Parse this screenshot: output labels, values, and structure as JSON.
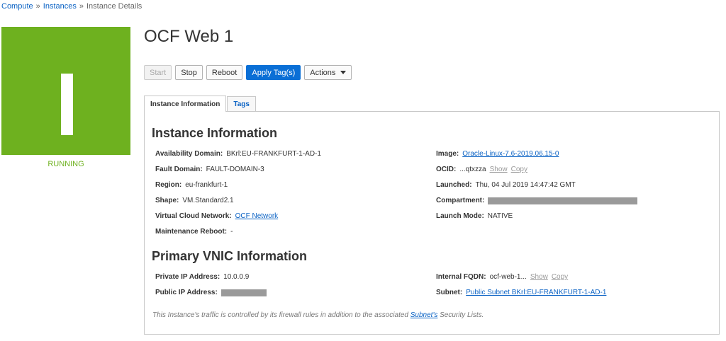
{
  "breadcrumb": {
    "compute": "Compute",
    "instances": "Instances",
    "current": "Instance Details",
    "sep": "»"
  },
  "status": {
    "label": "RUNNING",
    "color": "#6eb11f"
  },
  "title": "OCF Web 1",
  "toolbar": {
    "start": "Start",
    "stop": "Stop",
    "reboot": "Reboot",
    "apply_tags": "Apply Tag(s)",
    "actions": "Actions"
  },
  "tabs": {
    "info": "Instance Information",
    "tags": "Tags"
  },
  "instance_info": {
    "heading": "Instance Information",
    "availability_domain": {
      "label": "Availability Domain:",
      "value": "BKrl:EU-FRANKFURT-1-AD-1"
    },
    "fault_domain": {
      "label": "Fault Domain:",
      "value": "FAULT-DOMAIN-3"
    },
    "region": {
      "label": "Region:",
      "value": "eu-frankfurt-1"
    },
    "shape": {
      "label": "Shape:",
      "value": "VM.Standard2.1"
    },
    "vcn": {
      "label": "Virtual Cloud Network:",
      "value": "OCF Network"
    },
    "maintenance_reboot": {
      "label": "Maintenance Reboot:",
      "value": "-"
    },
    "image": {
      "label": "Image:",
      "value": "Oracle-Linux-7.6-2019.06.15-0"
    },
    "ocid": {
      "label": "OCID:",
      "value": "...qtxzza",
      "show": "Show",
      "copy": "Copy"
    },
    "launched": {
      "label": "Launched:",
      "value": "Thu, 04 Jul 2019 14:47:42 GMT"
    },
    "compartment": {
      "label": "Compartment:"
    },
    "launch_mode": {
      "label": "Launch Mode:",
      "value": "NATIVE"
    }
  },
  "vnic_info": {
    "heading": "Primary VNIC Information",
    "private_ip": {
      "label": "Private IP Address:",
      "value": "10.0.0.9"
    },
    "public_ip": {
      "label": "Public IP Address:"
    },
    "internal_fqdn": {
      "label": "Internal FQDN:",
      "value": "ocf-web-1...",
      "show": "Show",
      "copy": "Copy"
    },
    "subnet": {
      "label": "Subnet:",
      "value": "Public Subnet BKrl:EU-FRANKFURT-1-AD-1"
    }
  },
  "note": {
    "before": "This Instance's traffic is controlled by its firewall rules in addition to the associated ",
    "link": "Subnet's",
    "after": " Security Lists."
  }
}
